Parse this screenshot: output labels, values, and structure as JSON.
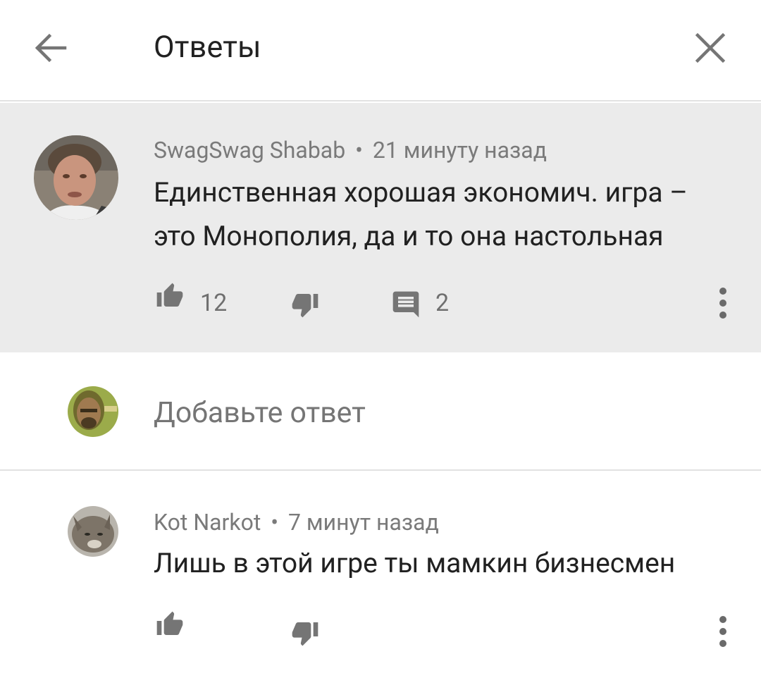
{
  "header": {
    "title": "Ответы",
    "back_icon": "arrow-back-icon",
    "close_icon": "close-icon"
  },
  "parent_comment": {
    "author": "SwagSwag Shabab",
    "separator": "•",
    "time": "21 минуту назад",
    "text_line1": "Единственная хорошая экономич. игра –",
    "text_line2": "это Монополия, да и то она настольная",
    "likes": "12",
    "replies": "2"
  },
  "reply_input": {
    "placeholder": "Добавьте ответ"
  },
  "replies": [
    {
      "author": "Kot Narkot",
      "separator": "•",
      "time": "7 минут назад",
      "text": "Лишь в этой игре ты мамкин бизнесмен"
    }
  ],
  "colors": {
    "highlight_bg": "#ebebeb",
    "icon": "#757575",
    "accent_dot": "#e53935"
  }
}
